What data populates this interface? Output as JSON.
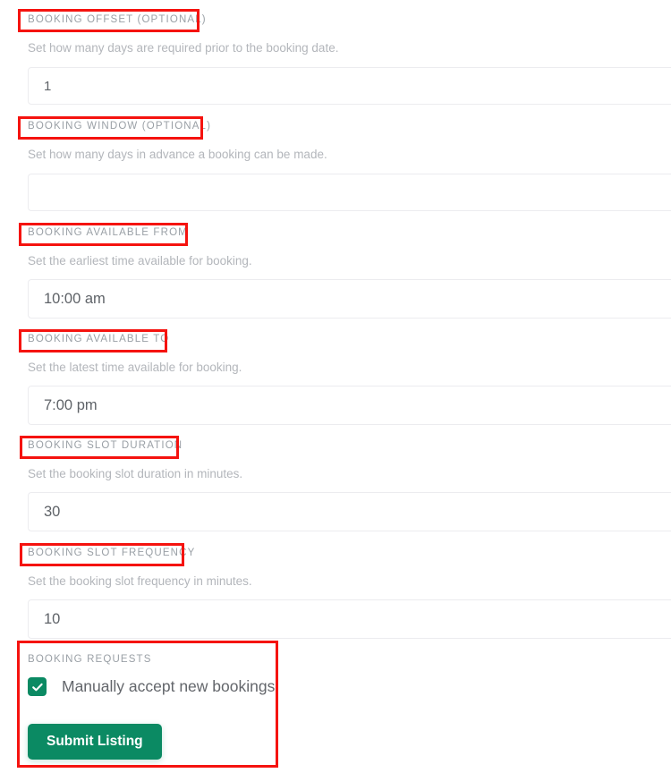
{
  "form": {
    "fields": [
      {
        "label": "BOOKING OFFSET (OPTIONAL)",
        "help": "Set how many days are required prior to the booking date.",
        "value": "1",
        "placeholder": "",
        "name": "booking-offset"
      },
      {
        "label": "BOOKING WINDOW (OPTIONAL)",
        "help": "Set how many days in advance a booking can be made.",
        "value": "",
        "placeholder": "",
        "name": "booking-window"
      },
      {
        "label": "BOOKING AVAILABLE FROM",
        "help": "Set the earliest time available for booking.",
        "value": "10:00 am",
        "placeholder": "",
        "name": "booking-available-from"
      },
      {
        "label": "BOOKING AVAILABLE TO",
        "help": "Set the latest time available for booking.",
        "value": "7:00 pm",
        "placeholder": "",
        "name": "booking-available-to"
      },
      {
        "label": "BOOKING SLOT DURATION",
        "help": "Set the booking slot duration in minutes.",
        "value": "30",
        "placeholder": "",
        "name": "booking-slot-duration"
      },
      {
        "label": "BOOKING SLOT FREQUENCY",
        "help": "Set the booking slot frequency in minutes.",
        "value": "10",
        "placeholder": "",
        "name": "booking-slot-frequency"
      }
    ],
    "requests": {
      "label": "BOOKING REQUESTS",
      "checkbox_label": "Manually accept new bookings",
      "checkbox_checked": true,
      "checkbox_icon": "check-icon",
      "submit_label": "Submit Listing"
    }
  },
  "colors": {
    "accent_green": "#0b8a63",
    "annotation_red": "#f5130f",
    "label_gray": "#9aa0a6",
    "help_gray": "#b3b6bb",
    "input_border": "#ececef",
    "input_text": "#5f6368"
  }
}
